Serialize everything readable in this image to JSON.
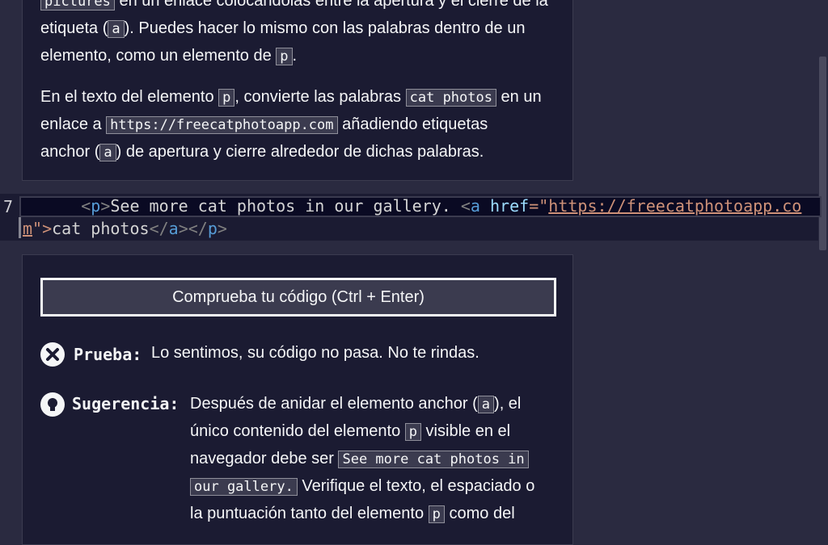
{
  "instructions": {
    "p1_cut_code": "pictures",
    "p1_cut_text": " en un enlace colocándolas entre la apertura y el cierre de la",
    "p1_line2_a": "etiqueta (",
    "p1_code_a": "a",
    "p1_line2_b": "). Puedes hacer lo mismo con las palabras dentro de un",
    "p1_line3_a": "elemento, como un elemento de ",
    "p1_code_p": "p",
    "p1_line3_b": ".",
    "p2_a": "En el texto del elemento ",
    "p2_code_p": "p",
    "p2_b": ", convierte las palabras ",
    "p2_code_cat": "cat photos",
    "p2_c": " en un",
    "p2_d": "enlace a ",
    "p2_code_url": "https://freecatphotoapp.com",
    "p2_e": " añadiendo etiquetas",
    "p2_f": "anchor (",
    "p2_code_a": "a",
    "p2_g": ") de apertura y cierre alrededor de dichas palabras."
  },
  "editor": {
    "line_number": "7",
    "indent": "      ",
    "t1": "<",
    "t2": "p",
    "t3": ">",
    "t4": "See more cat photos in our gallery. ",
    "t5": "<",
    "t6": "a",
    "t7": " href",
    "t8": "=\"",
    "t9": "https://freecatphotoapp.com",
    "t10": "\">",
    "t11": "cat photos",
    "t12": "</",
    "t13": "a",
    "t14": "></",
    "t15": "p",
    "t16": ">"
  },
  "feedback": {
    "check_button_label": "Comprueba tu código (Ctrl + Enter)",
    "test_label": "Prueba:",
    "test_text": "Lo sentimos, su código no pasa. No te rindas.",
    "hint_label": "Sugerencia:",
    "hint_l1_a": "Después de anidar el elemento anchor (",
    "hint_code_a": "a",
    "hint_l1_b": "), el",
    "hint_l2_a": "único contenido del elemento ",
    "hint_code_p": "p",
    "hint_l2_b": " visible en el",
    "hint_l3_a": "navegador debe ser ",
    "hint_code_see1": "See more cat photos in",
    "hint_code_see2": "our gallery.",
    "hint_l4_b": " Verifique el texto, el espaciado o",
    "hint_l5_a": "la puntuación tanto del elemento ",
    "hint_code_p2": "p",
    "hint_l5_b": " como del"
  },
  "colors": {
    "background": "#2a2a40",
    "panel": "#1b1b32",
    "editor_bg": "#0a0a23",
    "tag": "#569cd6",
    "string": "#ce9178"
  }
}
